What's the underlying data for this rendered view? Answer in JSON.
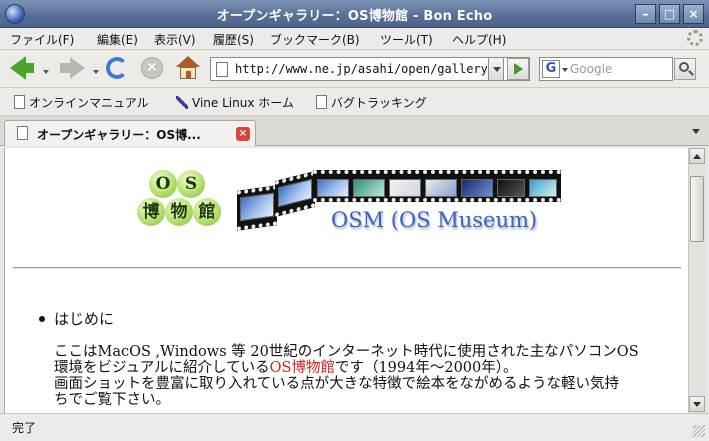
{
  "window": {
    "title": "オープンギャラリー：OS博物館 - Bon Echo"
  },
  "menubar": {
    "items": [
      "ファイル(F)",
      "編集(E)",
      "表示(V)",
      "履歴(S)",
      "ブックマーク(B)",
      "ツール(T)",
      "ヘルプ(H)"
    ]
  },
  "navigation": {
    "url": "http://www.ne.jp/asahi/open/gallery/",
    "search_engine": "G",
    "search_placeholder": "Google"
  },
  "bookmarks": {
    "items": [
      "オンラインマニュアル",
      "Vine Linux ホーム",
      "バグトラッキング"
    ]
  },
  "tabs": {
    "active": "オープンギャラリー：OS博..."
  },
  "page": {
    "logo_chars": [
      "O",
      "S",
      "博",
      "物",
      "館"
    ],
    "osm_title": "OSM (OS Museum)",
    "intro_heading": "はじめに",
    "para_line1": "ここはMacOS ,Windows 等 20世紀のインターネット時代に使用された主なパソコンOS",
    "para_line2_before": "環境をビジュアルに紹介している",
    "para_line2_link": "OS博物館",
    "para_line2_after": "です（1994年〜2000年）。",
    "para_line3": "画面ショットを豊富に取り入れている点が大きな特徴で絵本をながめるような軽い気持",
    "para_line4": "ちでご覧下さい。"
  },
  "status": {
    "text": "完了"
  }
}
